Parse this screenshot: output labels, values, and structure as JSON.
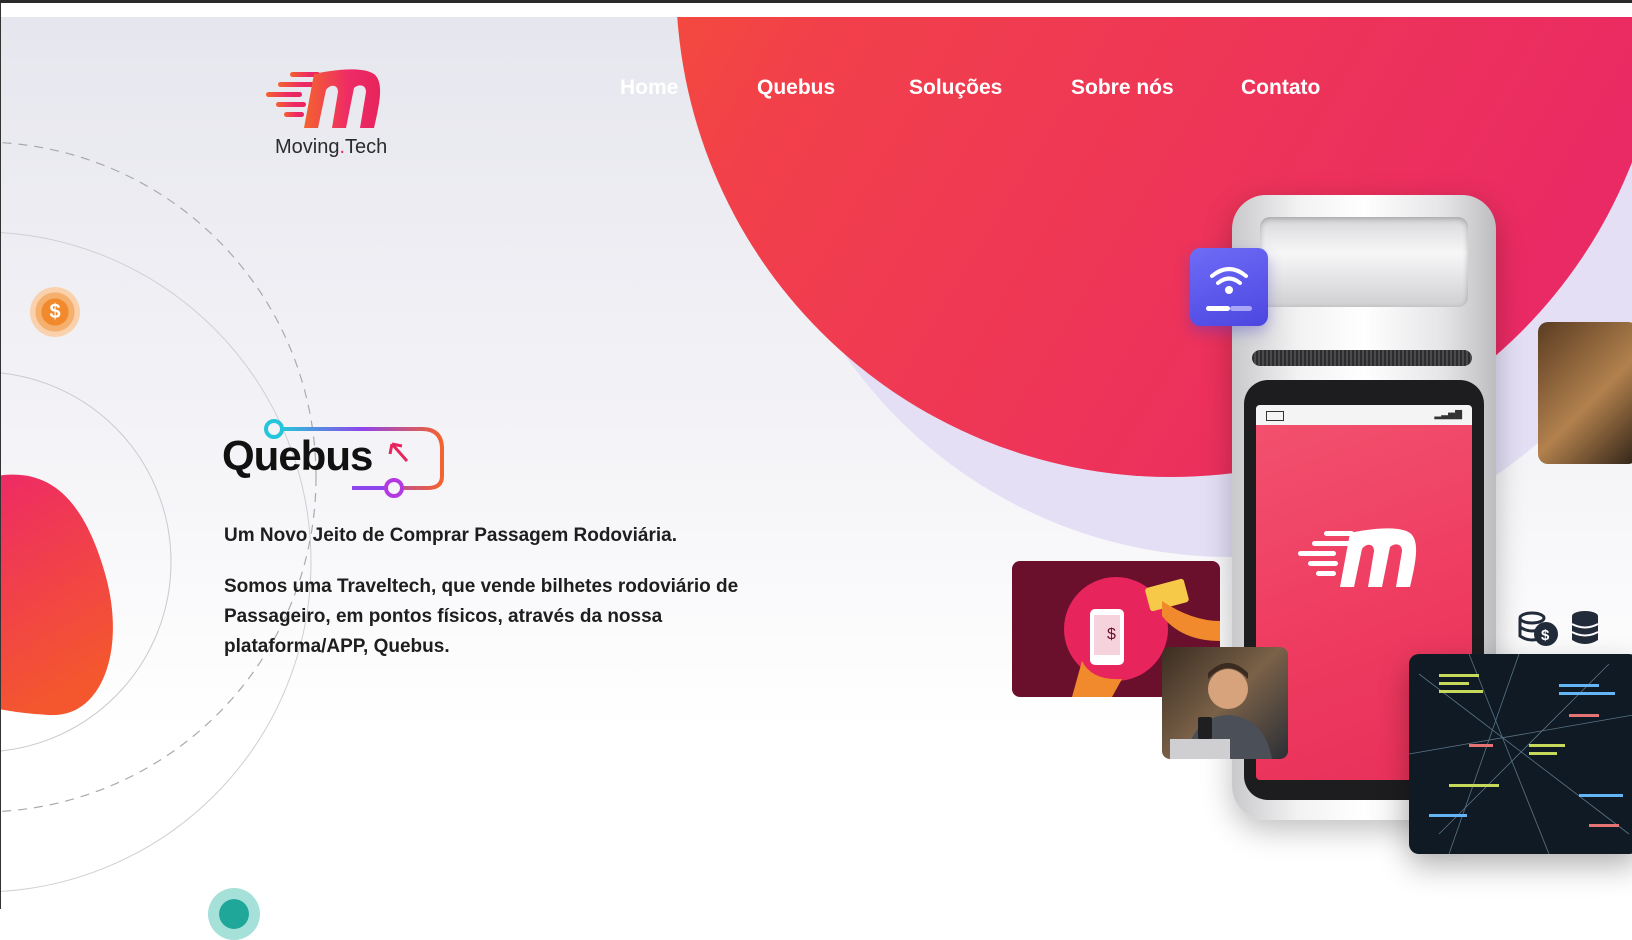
{
  "header": {
    "logo_text_left": "Moving",
    "logo_dot": ".",
    "logo_text_right": "Tech"
  },
  "nav": {
    "items": [
      {
        "label": "Home"
      },
      {
        "label": "Quebus"
      },
      {
        "label": "Soluções"
      },
      {
        "label": "Sobre nós"
      },
      {
        "label": "Contato"
      }
    ]
  },
  "hero": {
    "product_name": "Quebus",
    "tagline": "Um Novo Jeito de Comprar Passagem Rodoviária.",
    "description": "Somos uma Traveltech, que vende bilhetes rodoviário de Passageiro, em pontos físicos, através da nossa plataforma/APP, Quebus."
  },
  "decorations": {
    "coin_symbol": "$",
    "icons": [
      "dollar-coin-icon",
      "wifi-icon",
      "coins-stack-icon",
      "database-icon",
      "battery-icon",
      "signal-icon"
    ]
  },
  "colors": {
    "brand_pink": "#e8245d",
    "brand_orange": "#f4622e",
    "wifi_badge": "#5b55ea",
    "nav_text": "#ffffff"
  }
}
